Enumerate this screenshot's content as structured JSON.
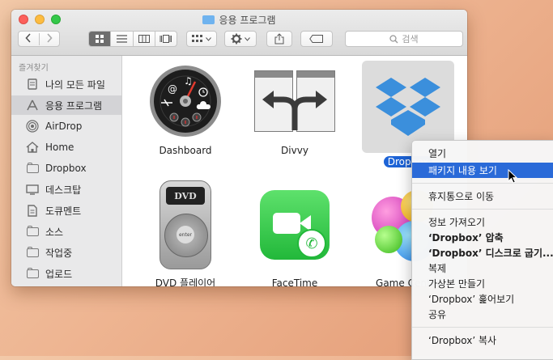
{
  "window": {
    "title": "응용 프로그램"
  },
  "toolbar": {
    "search_placeholder": "검색"
  },
  "sidebar": {
    "section_label": "즐겨찾기",
    "items": [
      {
        "label": "나의 모든 파일",
        "icon": "all-files-icon"
      },
      {
        "label": "응용 프로그램",
        "icon": "applications-icon",
        "selected": true
      },
      {
        "label": "AirDrop",
        "icon": "airdrop-icon"
      },
      {
        "label": "Home",
        "icon": "home-icon"
      },
      {
        "label": "Dropbox",
        "icon": "folder-icon"
      },
      {
        "label": "데스크탑",
        "icon": "desktop-icon"
      },
      {
        "label": "도큐멘트",
        "icon": "documents-icon"
      },
      {
        "label": "소스",
        "icon": "folder-icon"
      },
      {
        "label": "작업중",
        "icon": "folder-icon"
      },
      {
        "label": "업로드",
        "icon": "folder-icon"
      }
    ]
  },
  "apps": [
    {
      "label": "Dashboard"
    },
    {
      "label": "Divvy"
    },
    {
      "label": "Dropbox",
      "selected": true
    },
    {
      "label": "DVD 플레이어"
    },
    {
      "label": "FaceTime"
    },
    {
      "label": "Game Center"
    }
  ],
  "dvd_logo": "DVD",
  "dvd_enter": "enter",
  "context_menu": {
    "items": [
      {
        "label": "열기"
      },
      {
        "label": "패키지 내용 보기",
        "highlighted": true
      },
      {
        "label": "휴지통으로 이동"
      },
      {
        "label": "정보 가져오기"
      },
      {
        "label": "‘Dropbox’ 압축",
        "bold": true
      },
      {
        "label": "‘Dropbox’ 디스크로 굽기...",
        "bold": true
      },
      {
        "label": "복제"
      },
      {
        "label": "가상본 만들기"
      },
      {
        "label": "‘Dropbox’ 훑어보기"
      },
      {
        "label": "공유"
      },
      {
        "label": "‘Dropbox’ 복사"
      }
    ]
  },
  "colors": {
    "selection": "#1d63d6",
    "menu_highlight": "#2a6ad8",
    "dropbox_blue": "#3b8fdc"
  }
}
